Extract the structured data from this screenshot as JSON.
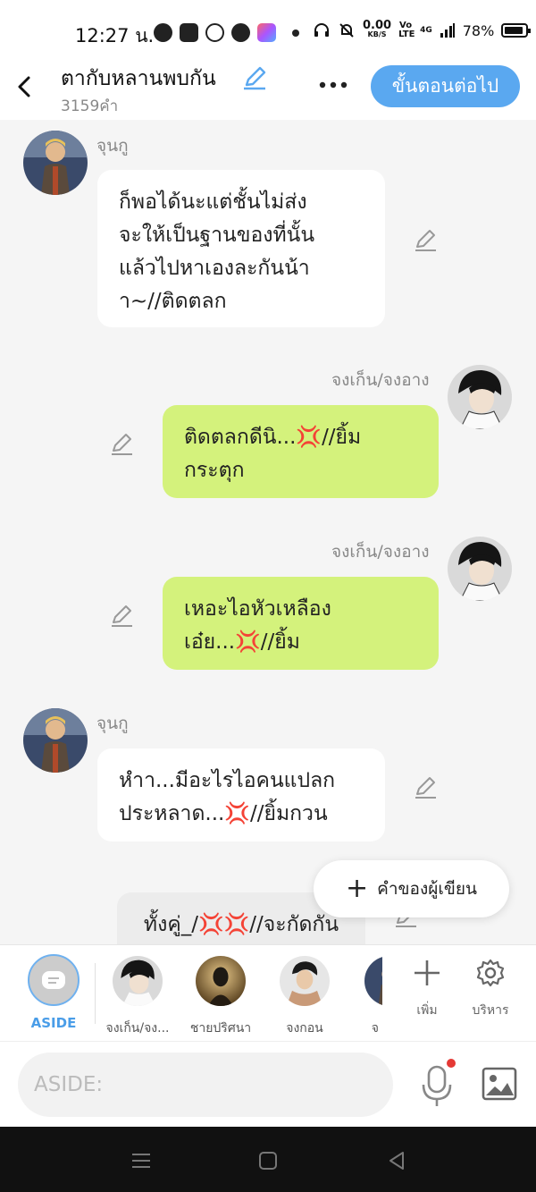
{
  "status_bar": {
    "time": "12:27 น.",
    "net_speed_value": "0.00",
    "net_speed_unit": "KB/S",
    "volte": "Vo LTE",
    "signal": "4G",
    "battery": "78%"
  },
  "header": {
    "title": "ตากับหลานพบกัน",
    "word_count": "3159คำ",
    "next_label": "ขั้นตอนต่อไป"
  },
  "messages": [
    {
      "sender": "จุนกู",
      "text": "ก็พอได้นะแต่ชั้นไม่ส่ง\nจะให้เป็นฐานของที่นั้น\nแล้วไปหาเองละกันน้า\nา~//ติดตลก",
      "side": "left"
    },
    {
      "sender": "จงเก็น/จงอาง",
      "text_before": "ติดตลกดีนิ...",
      "emoji": "💢",
      "text_after": "//ยิ้ม\nกระตุก",
      "side": "right"
    },
    {
      "sender": "จงเก็น/จงอาง",
      "text_before": "เหอะไอหัวเหลือง\nเอ๋ย...",
      "emoji": "💢",
      "text_after": "//ยิ้ม",
      "side": "right"
    },
    {
      "sender": "จุนกู",
      "text_before": "หำา...มีอะไรไอคนแปลก\nประหลาด...",
      "emoji": "💢",
      "text_after": "//ยิ้มกวน",
      "side": "left"
    },
    {
      "text_before": "ทั้งคู่_/",
      "emoji": "💢💢",
      "text_after": "//จะกัดกัน",
      "side": "center"
    }
  ],
  "fab": {
    "label": "คำของผู้เขียน"
  },
  "characters": {
    "aside_label": "ASIDE",
    "items": [
      {
        "name": "จงเก็น/จง..."
      },
      {
        "name": "ชายปริศนา"
      },
      {
        "name": "จงกอน"
      },
      {
        "name": "จ"
      }
    ],
    "add_label": "เพิ่ม",
    "manage_label": "บริหาร"
  },
  "input": {
    "placeholder": "ASIDE:"
  },
  "colors": {
    "accent": "#5aa8f0",
    "bubble_green": "#d4f27c",
    "bubble_white": "#ffffff",
    "background": "#f5f5f5"
  },
  "icons": [
    "back-icon",
    "pencil-icon",
    "more-icon",
    "plus-icon",
    "gear-icon",
    "mic-icon",
    "image-icon",
    "menu-icon",
    "home-icon",
    "back-triangle-icon"
  ]
}
